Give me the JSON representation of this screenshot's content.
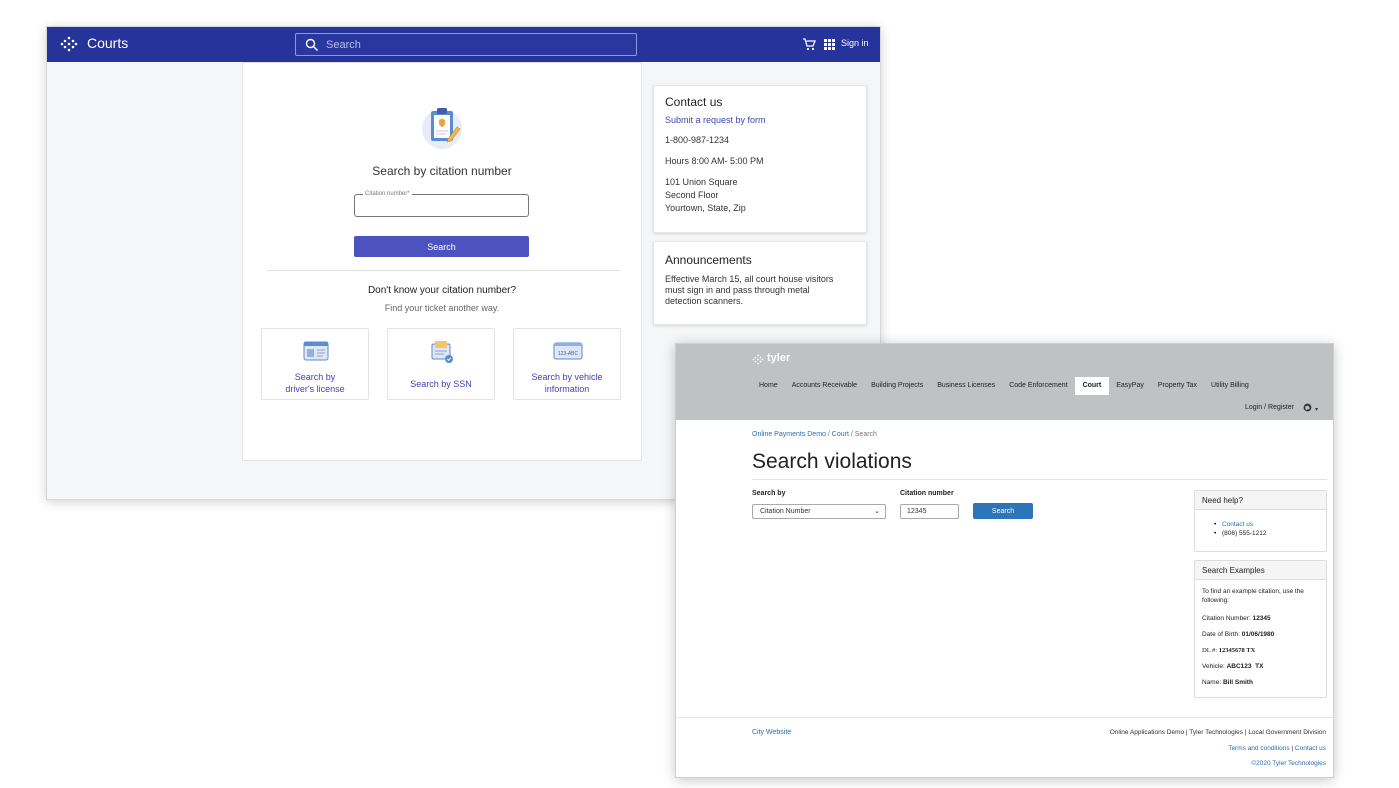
{
  "courts": {
    "app_title": "Courts",
    "search_placeholder": "Search",
    "sign_in": "Sign in",
    "heading": "Search by citation number",
    "field_label": "Citation number*",
    "search_button": "Search",
    "dont_know": "Don't know your citation number?",
    "find_another": "Find your ticket another way.",
    "options": [
      {
        "line1": "Search by",
        "line2": "driver's license"
      },
      {
        "line1": "Search by SSN"
      },
      {
        "line1": "Search by vehicle",
        "line2": "information"
      }
    ],
    "contact": {
      "title": "Contact us",
      "link": "Submit a request by form",
      "phone": "1-800-987-1234",
      "hours": "Hours 8:00 AM- 5:00 PM",
      "address1": "101 Union Square",
      "address2": "Second Floor",
      "address3": "Yourtown, State, Zip"
    },
    "announcements": {
      "title": "Announcements",
      "line1": "Effective March 15,  all court house visitors",
      "line2": "must sign in and pass through metal",
      "line3": "detection scanners."
    },
    "vehicle_plate": "123-ABC",
    "colors": {
      "header": "#26339a",
      "button": "#4c52c0",
      "link": "#3d45b0"
    }
  },
  "tyler": {
    "logo": "tyler",
    "nav": [
      "Home",
      "Accounts Receivable",
      "Building Projects",
      "Business Licenses",
      "Code Enforcement",
      "Court",
      "EasyPay",
      "Property Tax",
      "Utility Billing"
    ],
    "active_nav": "Court",
    "login": "Login / Register",
    "breadcrumb": {
      "b1": "Online Payments Demo",
      "b2": "Court",
      "b3": "Search",
      "sep": "/"
    },
    "title": "Search violations",
    "search_by_label": "Search by",
    "search_by_value": "Citation Number",
    "citation_label": "Citation number",
    "citation_value": "12345",
    "search_button": "Search",
    "help": {
      "title": "Need help?",
      "contact": "Contact us",
      "phone": "(806) 555-1212"
    },
    "examples": {
      "title": "Search Examples",
      "note1": "To find an example citation, use the",
      "note2": "following:",
      "citation_label": "Citation Number: ",
      "citation_value": "12345",
      "dob_label": "Date of Birth: ",
      "dob_value": "01/06/1980",
      "dl_label": "DL #: ",
      "dl_value": "12345678 TX",
      "vehicle_label": "Vehicle: ",
      "vehicle_value": "ABC123  TX",
      "name_label": "Name: ",
      "name_value": "Bill Smith"
    },
    "footer": {
      "city": "City Website",
      "line1": "Online Applications Demo | Tyler Technologies | Local Government Division",
      "terms": "Terms and conditions",
      "pipe": " | ",
      "contact": "Contact us",
      "copyright": "©2020 Tyler Technologies"
    },
    "colors": {
      "header": "#bfc2c2",
      "button": "#2d74b8",
      "link": "#2a6db0",
      "note": "#d41f1f"
    }
  }
}
